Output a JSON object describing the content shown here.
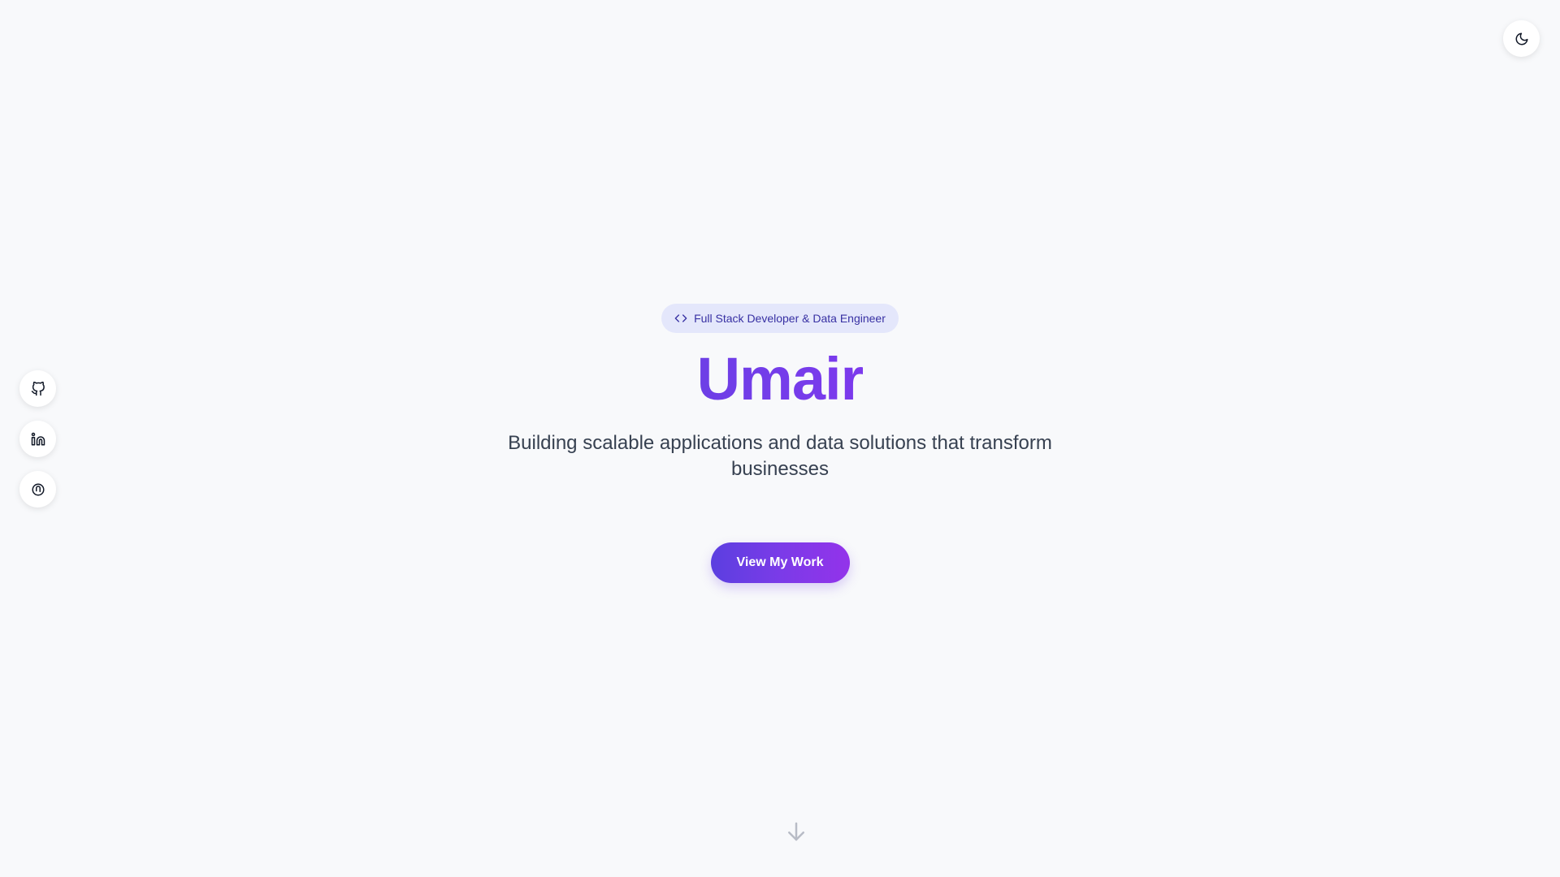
{
  "theme_toggle": {
    "icon": "moon-icon"
  },
  "social": [
    {
      "name": "github",
      "icon": "github-icon"
    },
    {
      "name": "linkedin",
      "icon": "linkedin-icon"
    },
    {
      "name": "upwork",
      "icon": "upwork-icon"
    }
  ],
  "hero": {
    "badge_text": "Full Stack Developer & Data Engineer",
    "badge_icon": "code-icon",
    "name": "Umair",
    "tagline": "Building scalable applications and data solutions that transform businesses",
    "cta_label": "View My Work"
  },
  "scroll_indicator": {
    "icon": "arrow-down-icon"
  },
  "colors": {
    "background": "#f8f9fb",
    "accent": "#7c3aed",
    "badge_bg": "#e4e7fb",
    "badge_text": "#3730a3",
    "text": "#374151"
  }
}
